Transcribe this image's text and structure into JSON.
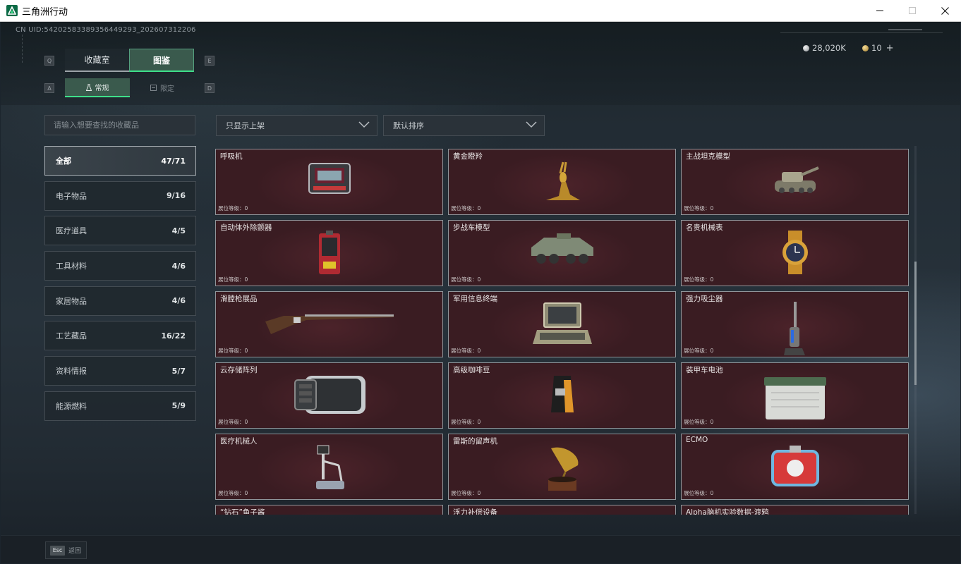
{
  "window": {
    "title": "三角洲行动"
  },
  "uid_text": "CN UID:5420258338935644929​3_202607312206",
  "currency": {
    "coins": "28,020K",
    "gems": "10",
    "plus": "+"
  },
  "keys": {
    "tab_prev": "Q",
    "tab_next": "E",
    "sub_prev": "A",
    "sub_next": "D"
  },
  "tabs": [
    {
      "label": "收藏室"
    },
    {
      "label": "图鉴"
    }
  ],
  "subtabs": [
    {
      "label": "常规"
    },
    {
      "label": "限定"
    }
  ],
  "search": {
    "placeholder": "请输入想要查找的收藏品"
  },
  "categories": [
    {
      "label": "全部",
      "count": "47/71"
    },
    {
      "label": "电子物品",
      "count": "9/16"
    },
    {
      "label": "医疗道具",
      "count": "4/5"
    },
    {
      "label": "工具材料",
      "count": "4/6"
    },
    {
      "label": "家居物品",
      "count": "4/6"
    },
    {
      "label": "工艺藏品",
      "count": "16/22"
    },
    {
      "label": "资料情报",
      "count": "5/7"
    },
    {
      "label": "能源燃料",
      "count": "5/9"
    }
  ],
  "filters": {
    "shelf": "只显示上架",
    "sort": "默认排序"
  },
  "level_label": "展位等级：0",
  "items": [
    {
      "name": "呼吸机",
      "icon": "ventilator-icon"
    },
    {
      "name": "黄金瞪羚",
      "icon": "golden-gazelle-icon"
    },
    {
      "name": "主战坦克模型",
      "icon": "tank-model-icon"
    },
    {
      "name": "自动体外除颤器",
      "icon": "defibrillator-icon"
    },
    {
      "name": "步战车模型",
      "icon": "ifv-model-icon"
    },
    {
      "name": "名贵机械表",
      "icon": "watch-icon"
    },
    {
      "name": "滑膛枪展品",
      "icon": "musket-icon"
    },
    {
      "name": "军用信息终端",
      "icon": "terminal-icon"
    },
    {
      "name": "强力吸尘器",
      "icon": "vacuum-icon"
    },
    {
      "name": "云存储阵列",
      "icon": "storage-array-icon"
    },
    {
      "name": "高级咖啡豆",
      "icon": "coffee-bag-icon"
    },
    {
      "name": "装甲车电池",
      "icon": "battery-icon"
    },
    {
      "name": "医疗机械人",
      "icon": "medical-robot-icon"
    },
    {
      "name": "雷斯的留声机",
      "icon": "gramophone-icon"
    },
    {
      "name": "ECMO",
      "icon": "ecmo-icon"
    },
    {
      "name": "“钻石”鱼子酱",
      "icon": "caviar-icon"
    },
    {
      "name": "浮力补偿设备",
      "icon": "bcd-icon"
    },
    {
      "name": "Alpha脑机实验数据-渡鸦",
      "icon": "data-icon"
    }
  ],
  "footer": {
    "esc_key": "Esc",
    "back_label": "返回"
  }
}
